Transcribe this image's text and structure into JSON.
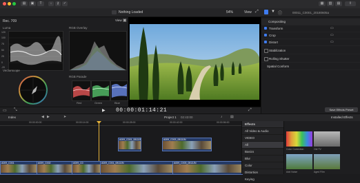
{
  "toolbar": {
    "center_title": "Nothing Loaded",
    "zoom": "54%",
    "view_label": "View",
    "clip_name": "00011_C0001_20180605a"
  },
  "scopes": {
    "panel_title": "Rec. 709",
    "luma_label": "Luma",
    "luma_ticks": [
      "120",
      "100",
      "75",
      "50",
      "25",
      "0",
      "-20"
    ],
    "overlay_label": "RGB Overlay",
    "view_label": "View",
    "vectorscope_label": "Vectorscope",
    "parade_label": "RGB Parade",
    "parade_channels": [
      "Red",
      "Green",
      "Blue"
    ]
  },
  "viewer": {
    "timecode": "00:00:01:14:21"
  },
  "inspector": {
    "section_compositing": "Compositing",
    "items": [
      "Transform",
      "Crop",
      "Distort",
      "Stabilization",
      "Rolling Shutter",
      "Spatial Conform"
    ],
    "save_button": "Save Effects Preset"
  },
  "timeline": {
    "index_label": "Index",
    "project_name": "Project 1",
    "duration": "02:43:00",
    "ruler": [
      "00:00:00:00",
      "00:00:14:00",
      "00:00:28:00",
      "00:00:42:00",
      "00:00:56:00"
    ],
    "upper_clips": [
      {
        "label": "A009_C001_0813JN"
      },
      {
        "label": "A009_C003_0813JN"
      }
    ],
    "main_clips": [
      {
        "label": "A009_C001"
      },
      {
        "label": "A009_C002"
      },
      {
        "label": "A009_C0"
      },
      {
        "label": "A009_C001_0813JN"
      },
      {
        "label": "A009_C003_0813JN"
      }
    ]
  },
  "effects": {
    "header": "Effects",
    "installed_label": "Installed Effects",
    "categories": [
      "All Video & Audio",
      "VIDEO",
      "All",
      "Basics",
      "Blur",
      "Color",
      "Distortion",
      "Keying"
    ],
    "selected_index": 2,
    "thumbs": [
      {
        "name": "Color Correction"
      },
      {
        "name": "Old TV"
      },
      {
        "name": "Add Noise"
      },
      {
        "name": "Aged Film"
      }
    ]
  },
  "colors": {
    "accent": "#3f7cf0",
    "clip_blue": "#253a66",
    "playhead": "#e8b43a"
  }
}
